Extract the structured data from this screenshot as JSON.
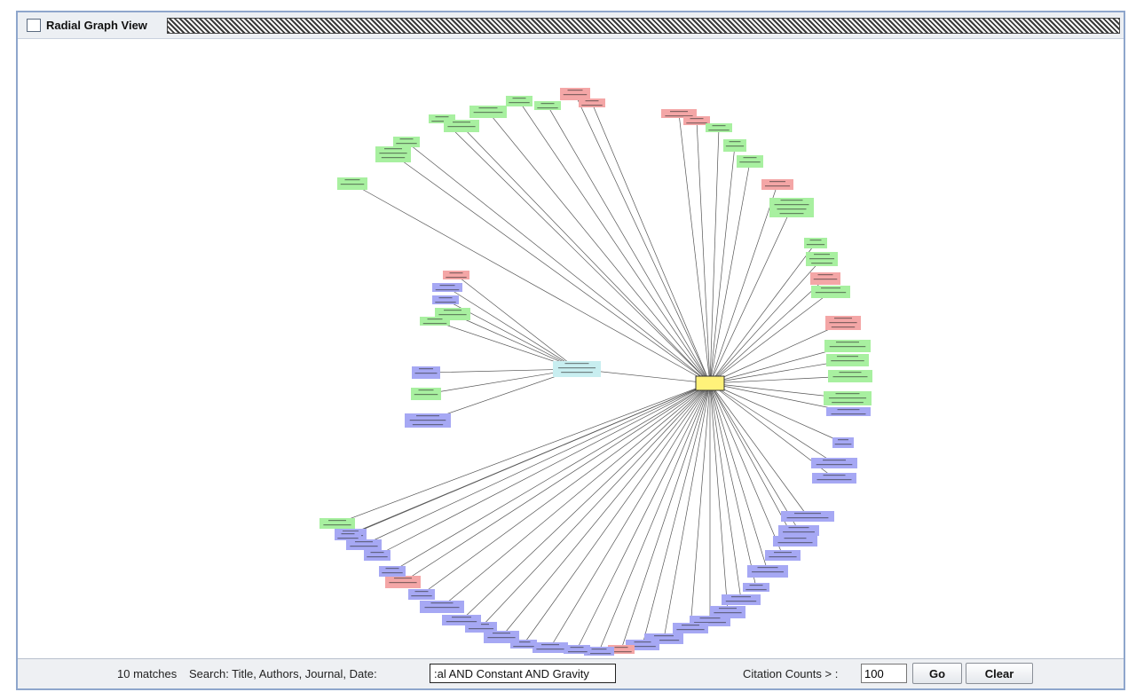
{
  "window": {
    "title": "Radial Graph View"
  },
  "toolbar": {
    "matches": "10 matches",
    "search_label": "Search: Title, Authors, Journal, Date:",
    "search_value": ":al AND Constant AND Gravity",
    "citation_label": "Citation Counts > :",
    "citation_value": "100",
    "go_label": "Go",
    "clear_label": "Clear"
  },
  "colors": {
    "green": "#a8f0a0",
    "red": "#f4a6a6",
    "blue": "#a6a8f4",
    "cyan": "#c8eef0",
    "center": "#fff27a",
    "edge": "#555555"
  }
}
